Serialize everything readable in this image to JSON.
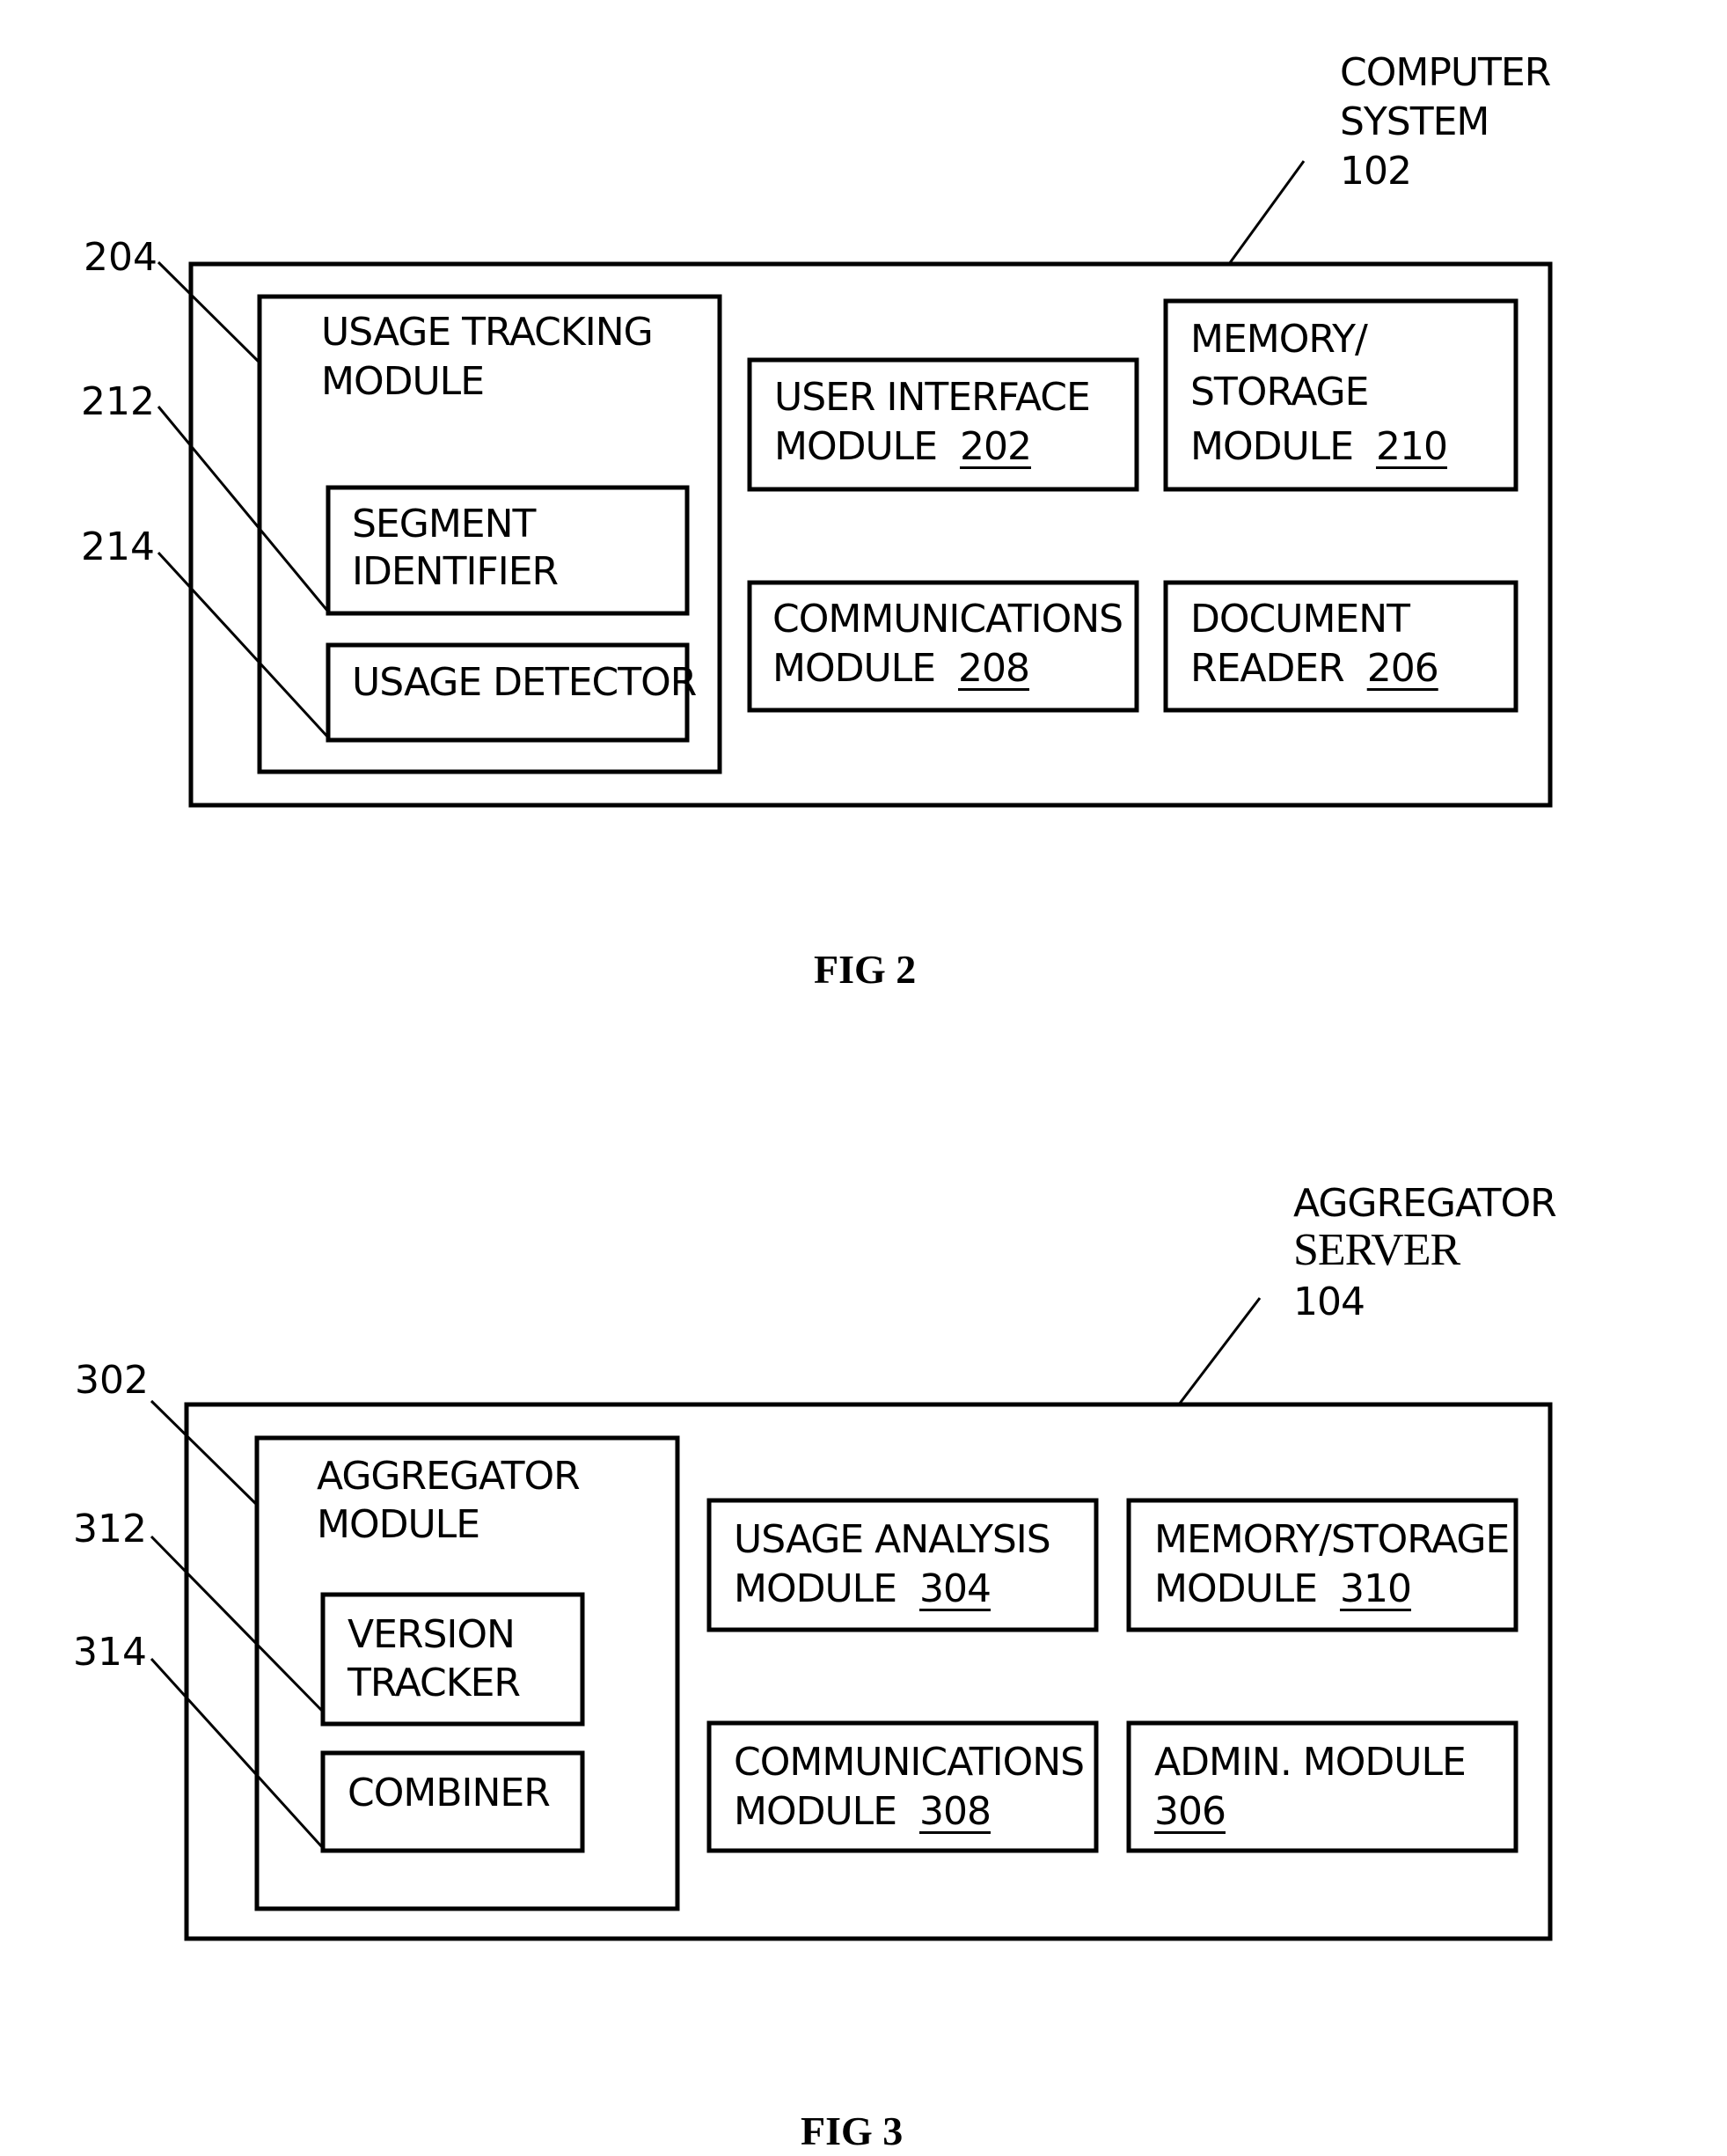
{
  "fig2": {
    "caption": "FIG 2",
    "system_label": [
      "COMPUTER",
      "SYSTEM",
      "102"
    ],
    "refs": [
      "204",
      "212",
      "214"
    ],
    "usage_tracking": [
      "USAGE TRACKING",
      "MODULE"
    ],
    "segment_identifier": [
      "SEGMENT",
      "IDENTIFIER"
    ],
    "usage_detector": "USAGE DETECTOR",
    "ui_module": {
      "line1": "USER INTERFACE",
      "line2": "MODULE",
      "num": "202"
    },
    "memory_module": {
      "line1": "MEMORY/",
      "line2": "STORAGE",
      "line3": "MODULE",
      "num": "210"
    },
    "comm_module": {
      "line1": "COMMUNICATIONS",
      "line2": "MODULE",
      "num": "208"
    },
    "doc_reader": {
      "line1": "DOCUMENT",
      "line2": "READER",
      "num": "206"
    }
  },
  "fig3": {
    "caption": "FIG 3",
    "server_label": [
      "AGGREGATOR",
      "SERVER",
      "104"
    ],
    "refs": [
      "302",
      "312",
      "314"
    ],
    "aggregator_module": [
      "AGGREGATOR",
      "MODULE"
    ],
    "version_tracker": [
      "VERSION",
      "TRACKER"
    ],
    "combiner": "COMBINER",
    "usage_analysis": {
      "line1": "USAGE ANALYSIS",
      "line2": "MODULE",
      "num": "304"
    },
    "memory_storage": {
      "line1": "MEMORY/STORAGE",
      "line2": "MODULE",
      "num": "310"
    },
    "comm_module": {
      "line1": "COMMUNICATIONS",
      "line2": "MODULE",
      "num": "308"
    },
    "admin_module": {
      "line1": "ADMIN. MODULE",
      "num": "306"
    }
  }
}
